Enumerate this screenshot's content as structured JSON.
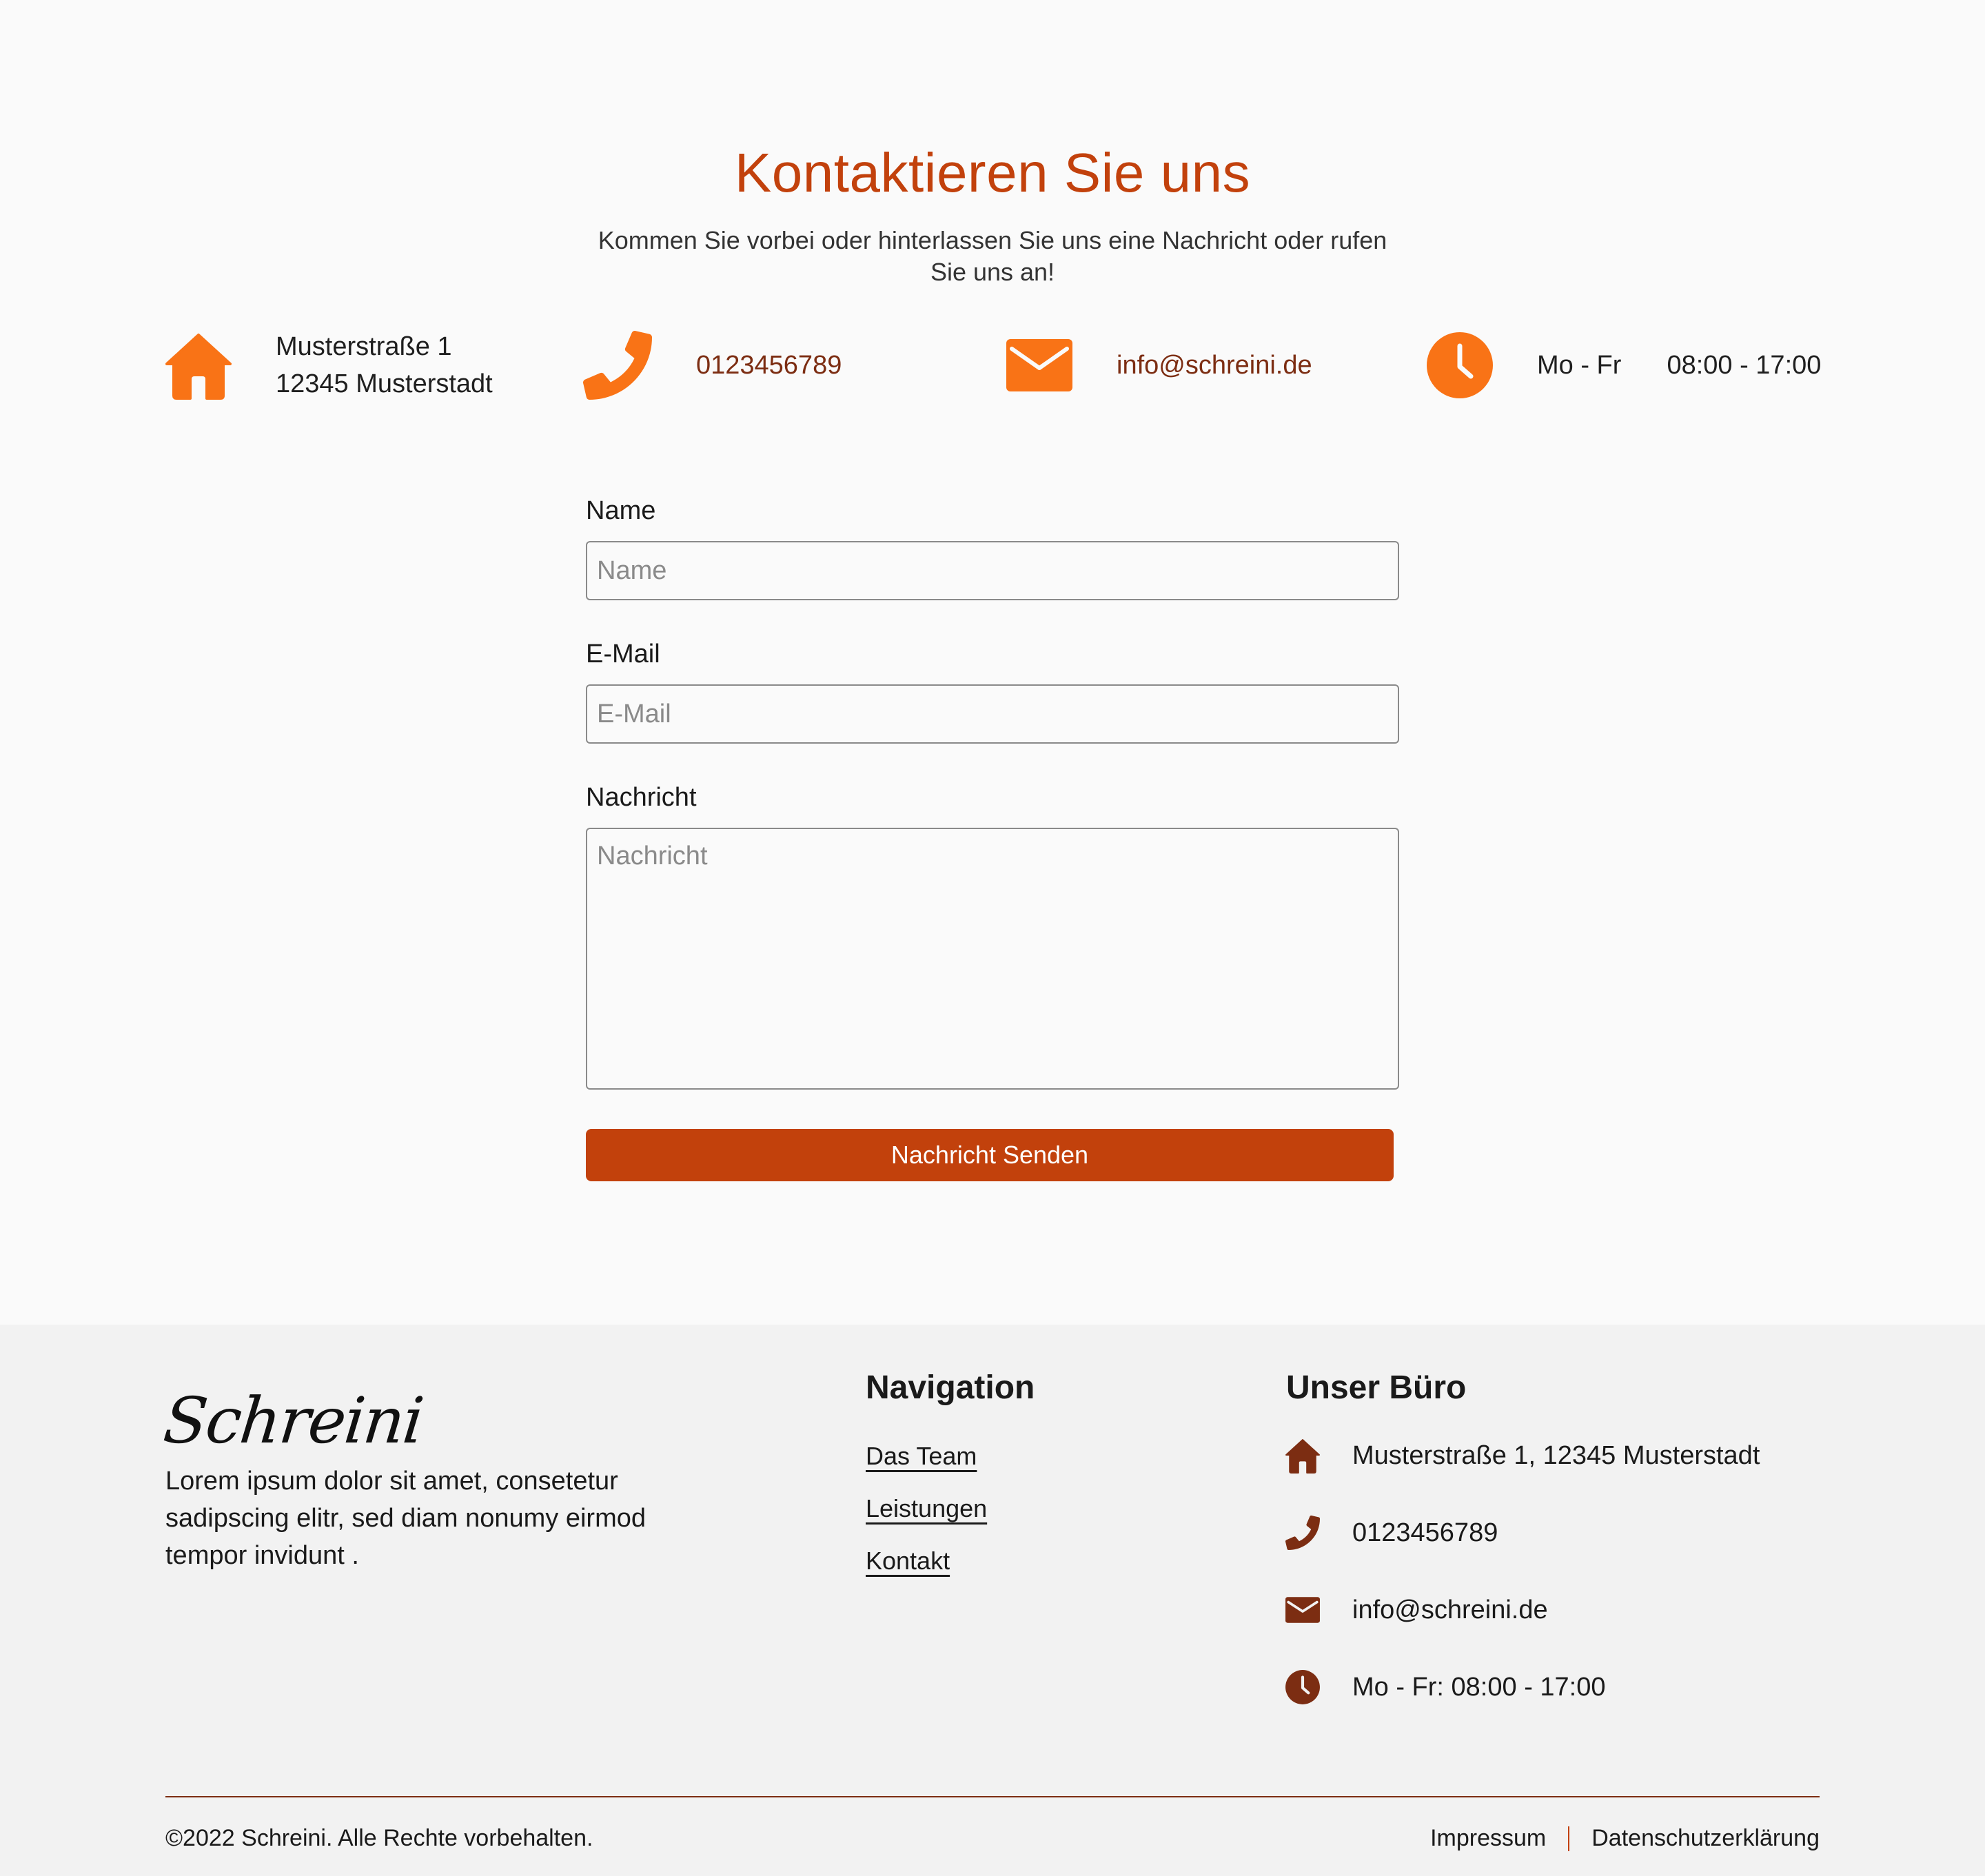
{
  "colors": {
    "accent": "#c2410c",
    "icon_orange": "#f97316",
    "icon_dark": "#7c2d12",
    "link_text": "#7c2d12",
    "footer_bg": "#f2f2f2",
    "page_bg": "#fafafa"
  },
  "contact": {
    "title": "Kontaktieren Sie uns",
    "subtitle": "Kommen Sie vorbei oder hinterlassen Sie uns eine Nachricht oder rufen Sie uns an!",
    "info": {
      "address_icon": "home-icon",
      "address_line1": "Musterstraße 1",
      "address_line2": "12345 Musterstadt",
      "phone_icon": "phone-icon",
      "phone": "0123456789",
      "email_icon": "envelope-icon",
      "email": "info@schreini.de",
      "hours_icon": "clock-icon",
      "hours_days": "Mo - Fr",
      "hours_time": "08:00 - 17:00"
    }
  },
  "form": {
    "name_label": "Name",
    "name_placeholder": "Name",
    "email_label": "E-Mail",
    "email_placeholder": "E-Mail",
    "message_label": "Nachricht",
    "message_placeholder": "Nachricht",
    "submit_label": "Nachricht Senden"
  },
  "footer": {
    "logo": "Schreini",
    "description": "Lorem ipsum dolor sit amet, consetetur sadipscing elitr, sed diam nonumy eirmod tempor invidunt .",
    "navigation_heading": "Navigation",
    "nav_links": [
      "Das Team",
      "Leistungen",
      "Kontakt"
    ],
    "office_heading": "Unser Büro",
    "office": [
      {
        "icon": "home-icon",
        "text": "Musterstraße 1, 12345 Musterstadt"
      },
      {
        "icon": "phone-icon",
        "text": "0123456789"
      },
      {
        "icon": "envelope-icon",
        "text": "info@schreini.de"
      },
      {
        "icon": "clock-icon",
        "text": "Mo - Fr: 08:00 - 17:00"
      }
    ],
    "copyright": "©2022 Schreini. Alle Rechte vorbehalten.",
    "legal_links": [
      "Impressum",
      "Datenschutzerklärung"
    ]
  }
}
